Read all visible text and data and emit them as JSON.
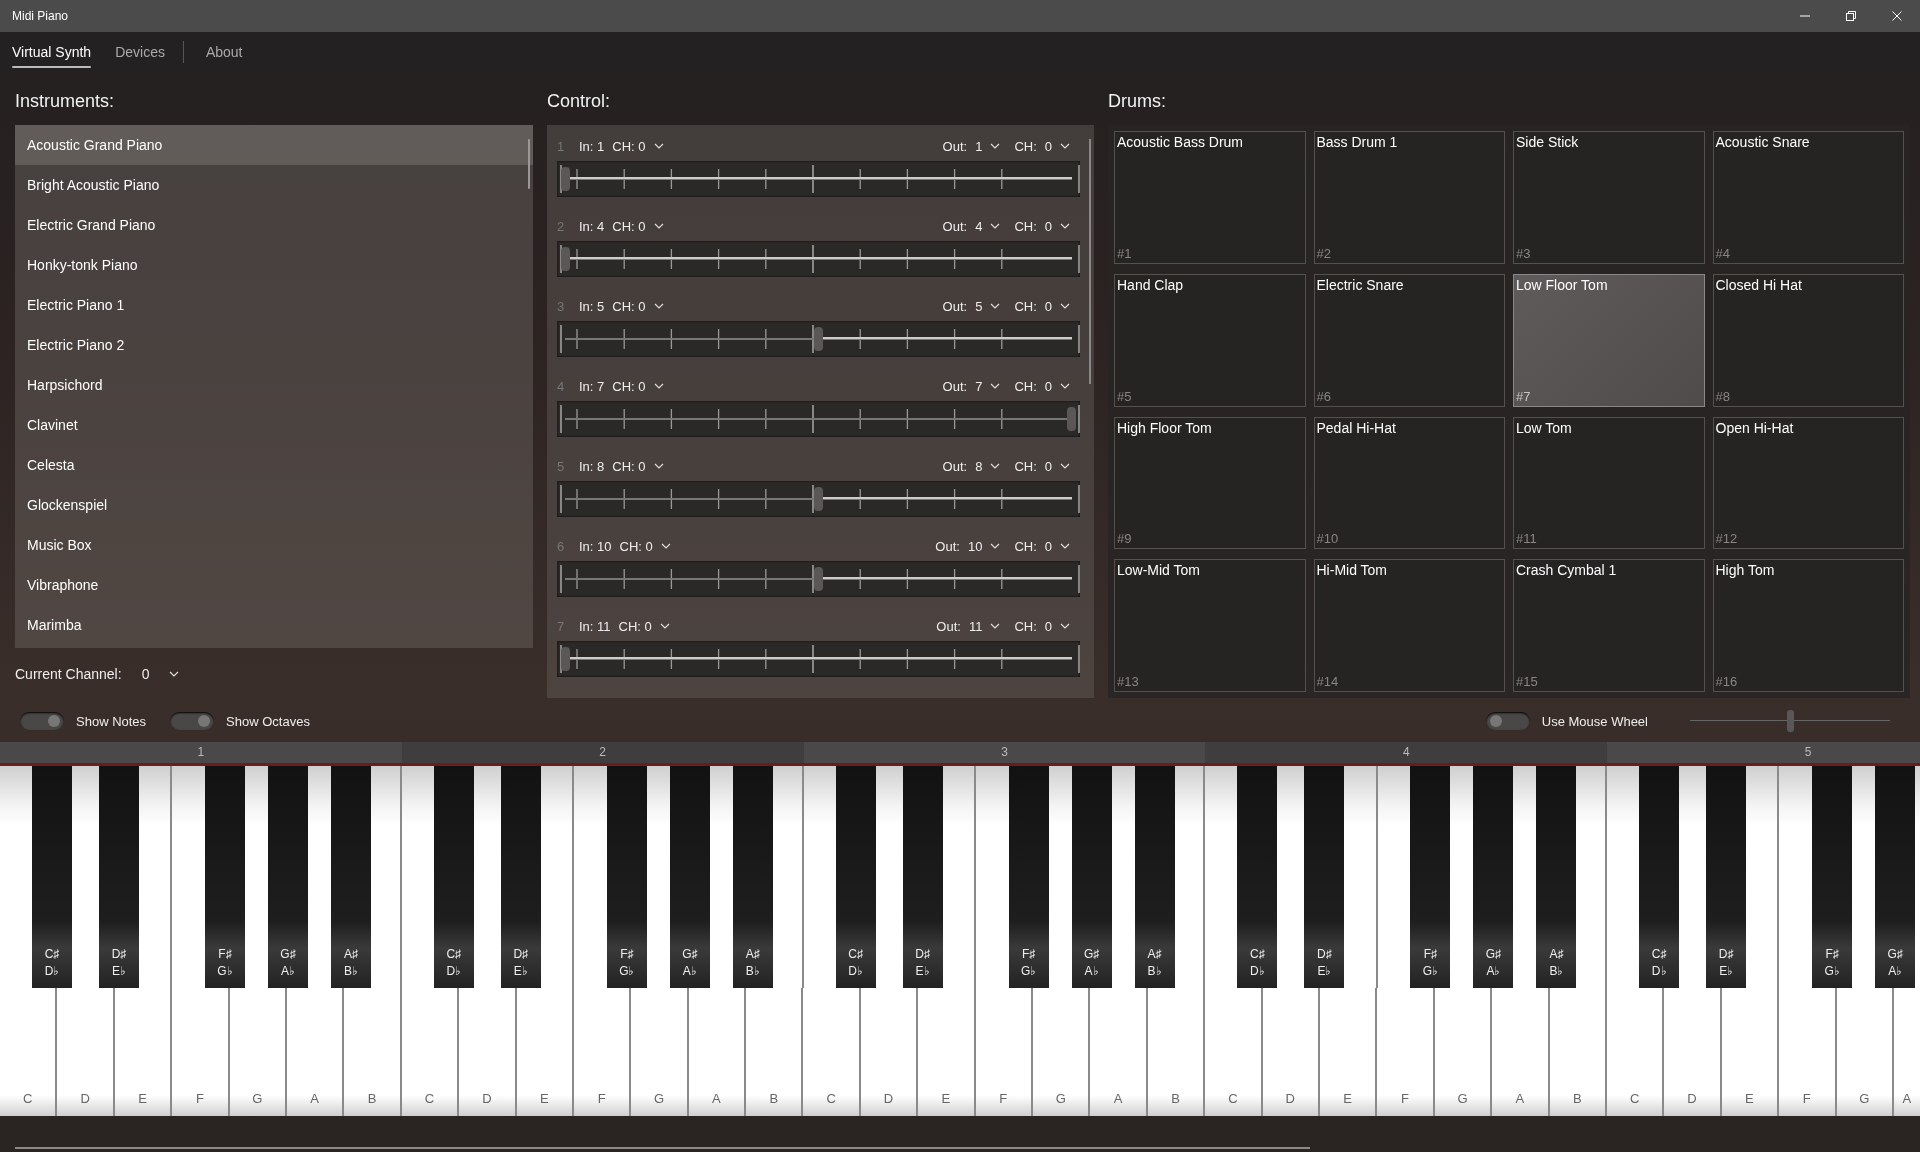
{
  "window": {
    "title": "Midi Piano"
  },
  "tabs": [
    {
      "label": "Virtual Synth",
      "selected": true,
      "kind": "page"
    },
    {
      "label": "Devices",
      "selected": false,
      "kind": "page"
    },
    {
      "label": "About",
      "selected": false,
      "kind": "info"
    }
  ],
  "instruments": {
    "heading": "Instruments:",
    "items": [
      {
        "name": "Acoustic Grand Piano",
        "selected": true
      },
      {
        "name": "Bright Acoustic Piano",
        "selected": false
      },
      {
        "name": "Electric Grand Piano",
        "selected": false
      },
      {
        "name": "Honky-tonk Piano",
        "selected": false
      },
      {
        "name": "Electric Piano 1",
        "selected": false
      },
      {
        "name": "Electric Piano 2",
        "selected": false
      },
      {
        "name": "Harpsichord",
        "selected": false
      },
      {
        "name": "Clavinet",
        "selected": false
      },
      {
        "name": "Celesta",
        "selected": false
      },
      {
        "name": "Glockenspiel",
        "selected": false
      },
      {
        "name": "Music Box",
        "selected": false
      },
      {
        "name": "Vibraphone",
        "selected": false
      },
      {
        "name": "Marimba",
        "selected": false
      }
    ],
    "current_channel": {
      "label": "Current Channel:",
      "value": "0"
    }
  },
  "control": {
    "heading": "Control:",
    "rows": [
      {
        "number": "1",
        "in": "In: 1",
        "in_ch": "CH: 0",
        "out_label": "Out:",
        "out": "1",
        "ch_label": "CH:",
        "ch": "0",
        "level": 0
      },
      {
        "number": "2",
        "in": "In: 4",
        "in_ch": "CH: 0",
        "out_label": "Out:",
        "out": "4",
        "ch_label": "CH:",
        "ch": "0",
        "level": 0
      },
      {
        "number": "3",
        "in": "In: 5",
        "in_ch": "CH: 0",
        "out_label": "Out:",
        "out": "5",
        "ch_label": "CH:",
        "ch": "0",
        "level": 0.5
      },
      {
        "number": "4",
        "in": "In: 7",
        "in_ch": "CH: 0",
        "out_label": "Out:",
        "out": "7",
        "ch_label": "CH:",
        "ch": "0",
        "level": 1
      },
      {
        "number": "5",
        "in": "In: 8",
        "in_ch": "CH: 0",
        "out_label": "Out:",
        "out": "8",
        "ch_label": "CH:",
        "ch": "0",
        "level": 0.5
      },
      {
        "number": "6",
        "in": "In: 10",
        "in_ch": "CH: 0",
        "out_label": "Out:",
        "out": "10",
        "ch_label": "CH:",
        "ch": "0",
        "level": 0.5
      },
      {
        "number": "7",
        "in": "In: 11",
        "in_ch": "CH: 0",
        "out_label": "Out:",
        "out": "11",
        "ch_label": "CH:",
        "ch": "0",
        "level": 0
      }
    ]
  },
  "drums": {
    "heading": "Drums:",
    "pads": [
      {
        "name": "Acoustic Bass Drum",
        "number": "#1",
        "selected": false
      },
      {
        "name": "Bass Drum 1",
        "number": "#2",
        "selected": false
      },
      {
        "name": "Side Stick",
        "number": "#3",
        "selected": false
      },
      {
        "name": "Acoustic Snare",
        "number": "#4",
        "selected": false
      },
      {
        "name": "Hand Clap",
        "number": "#5",
        "selected": false
      },
      {
        "name": "Electric Snare",
        "number": "#6",
        "selected": false
      },
      {
        "name": "Low Floor Tom",
        "number": "#7",
        "selected": true
      },
      {
        "name": "Closed Hi Hat",
        "number": "#8",
        "selected": false
      },
      {
        "name": "High Floor Tom",
        "number": "#9",
        "selected": false
      },
      {
        "name": "Pedal Hi-Hat",
        "number": "#10",
        "selected": false
      },
      {
        "name": "Low Tom",
        "number": "#11",
        "selected": false
      },
      {
        "name": "Open Hi-Hat",
        "number": "#12",
        "selected": false
      },
      {
        "name": "Low-Mid Tom",
        "number": "#13",
        "selected": false
      },
      {
        "name": "Hi-Mid Tom",
        "number": "#14",
        "selected": false
      },
      {
        "name": "Crash Cymbal 1",
        "number": "#15",
        "selected": false
      },
      {
        "name": "High Tom",
        "number": "#16",
        "selected": false
      }
    ]
  },
  "options": {
    "toggles": [
      {
        "label": "Show Notes",
        "on": true
      },
      {
        "label": "Show Octaves",
        "on": true
      },
      {
        "label": "Use Mouse Wheel",
        "on": false
      }
    ],
    "slider": {
      "level": 0.5
    }
  },
  "piano": {
    "octaves": [
      "1",
      "2",
      "3",
      "4",
      "5"
    ],
    "white_keys": [
      "C",
      "D",
      "E",
      "F",
      "G",
      "A",
      "B",
      "C",
      "D",
      "E",
      "F",
      "G",
      "A",
      "B",
      "C",
      "D",
      "E",
      "F",
      "G",
      "A",
      "B",
      "C",
      "D",
      "E",
      "F",
      "G",
      "A",
      "B",
      "C",
      "D",
      "E",
      "F",
      "G",
      "A"
    ],
    "black_keys": [
      {
        "sharp": "C♯",
        "flat": "D♭"
      },
      {
        "sharp": "D♯",
        "flat": "E♭"
      },
      {
        "sharp": "F♯",
        "flat": "G♭"
      },
      {
        "sharp": "G♯",
        "flat": "A♭"
      },
      {
        "sharp": "A♯",
        "flat": "B♭"
      },
      {
        "sharp": "C♯",
        "flat": "D♭"
      },
      {
        "sharp": "D♯",
        "flat": "E♭"
      },
      {
        "sharp": "F♯",
        "flat": "G♭"
      },
      {
        "sharp": "G♯",
        "flat": "A♭"
      },
      {
        "sharp": "A♯",
        "flat": "B♭"
      },
      {
        "sharp": "C♯",
        "flat": "D♭"
      },
      {
        "sharp": "D♯",
        "flat": "E♭"
      },
      {
        "sharp": "F♯",
        "flat": "G♭"
      },
      {
        "sharp": "G♯",
        "flat": "A♭"
      },
      {
        "sharp": "A♯",
        "flat": "B♭"
      },
      {
        "sharp": "C♯",
        "flat": "D♭"
      },
      {
        "sharp": "D♯",
        "flat": "E♭"
      },
      {
        "sharp": "F♯",
        "flat": "G♭"
      },
      {
        "sharp": "G♯",
        "flat": "A♭"
      },
      {
        "sharp": "A♯",
        "flat": "B♭"
      },
      {
        "sharp": "C♯",
        "flat": "D♭"
      },
      {
        "sharp": "D♯",
        "flat": "E♭"
      },
      {
        "sharp": "F♯",
        "flat": "G♭"
      },
      {
        "sharp": "G♯",
        "flat": "A♭"
      }
    ]
  }
}
